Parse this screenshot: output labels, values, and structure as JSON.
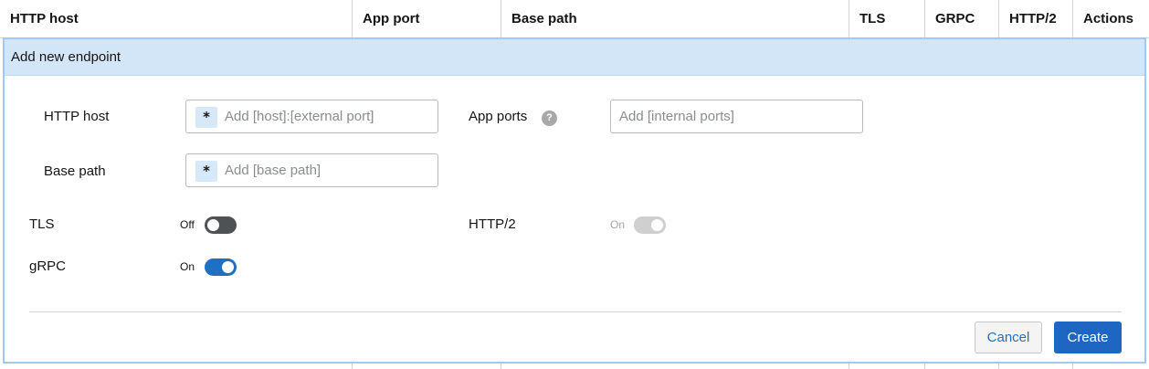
{
  "table": {
    "columns": [
      "HTTP host",
      "App port",
      "Base path",
      "TLS",
      "GRPC",
      "HTTP/2",
      "Actions"
    ]
  },
  "panel": {
    "title": "Add new endpoint",
    "fields": {
      "http_host": {
        "label": "HTTP host",
        "placeholder": "Add [host]:[external port]",
        "required_mark": "*"
      },
      "app_ports": {
        "label": "App ports",
        "placeholder": "Add [internal ports]",
        "help_glyph": "?"
      },
      "base_path": {
        "label": "Base path",
        "placeholder": "Add [base path]",
        "required_mark": "*"
      }
    },
    "toggles": {
      "tls": {
        "label": "TLS",
        "state": "Off",
        "on": false,
        "disabled": false
      },
      "http2": {
        "label": "HTTP/2",
        "state": "On",
        "on": true,
        "disabled": true
      },
      "grpc": {
        "label": "gRPC",
        "state": "On",
        "on": true,
        "disabled": false
      }
    },
    "buttons": {
      "cancel": "Cancel",
      "create": "Create"
    }
  },
  "colors": {
    "panel_header_bg": "#d3e6f7",
    "panel_border": "#9fc9ee",
    "primary": "#1e66c2",
    "toggle_off": "#4f5255",
    "toggle_disabled": "#cfcfcf"
  },
  "icons": [
    "help-icon",
    "required-asterisk-icon"
  ]
}
